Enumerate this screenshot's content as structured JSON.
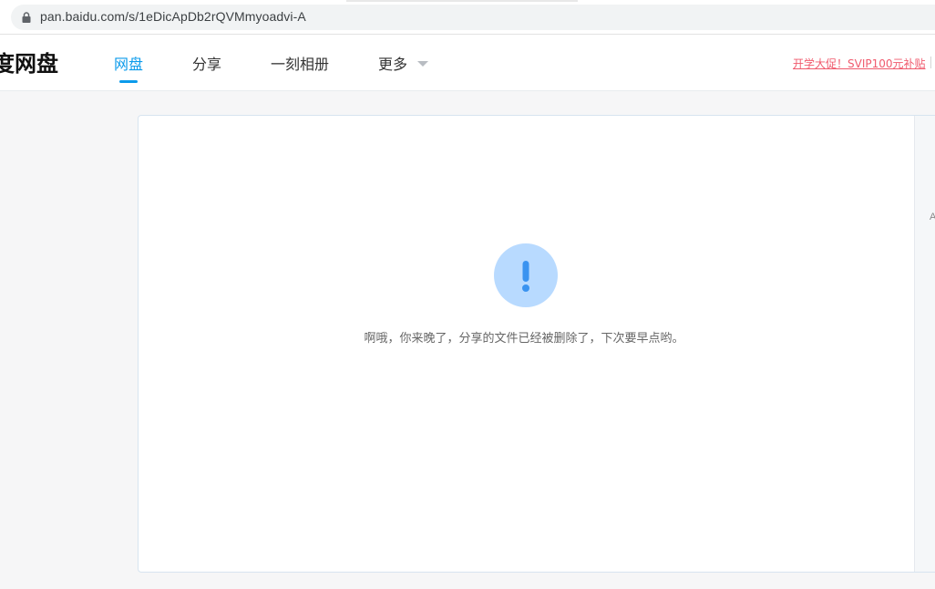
{
  "browser": {
    "url": "pan.baidu.com/s/1eDicApDb2rQVMmyoadvi-A"
  },
  "header": {
    "logo": "度网盘",
    "nav": [
      {
        "label": "网盘",
        "active": true
      },
      {
        "label": "分享",
        "active": false
      },
      {
        "label": "一刻相册",
        "active": false
      },
      {
        "label": "更多",
        "active": false
      }
    ],
    "promo": "开学大促！SVIP100元补贴"
  },
  "main": {
    "icon": "exclamation-icon",
    "message": "啊哦，你来晚了，分享的文件已经被删除了，下次要早点哟。",
    "side_text": "A"
  },
  "colors": {
    "accent": "#0c9beb",
    "promo": "#f05a6d",
    "alert_bg": "#b8daff",
    "alert_fg": "#3a93f0"
  }
}
